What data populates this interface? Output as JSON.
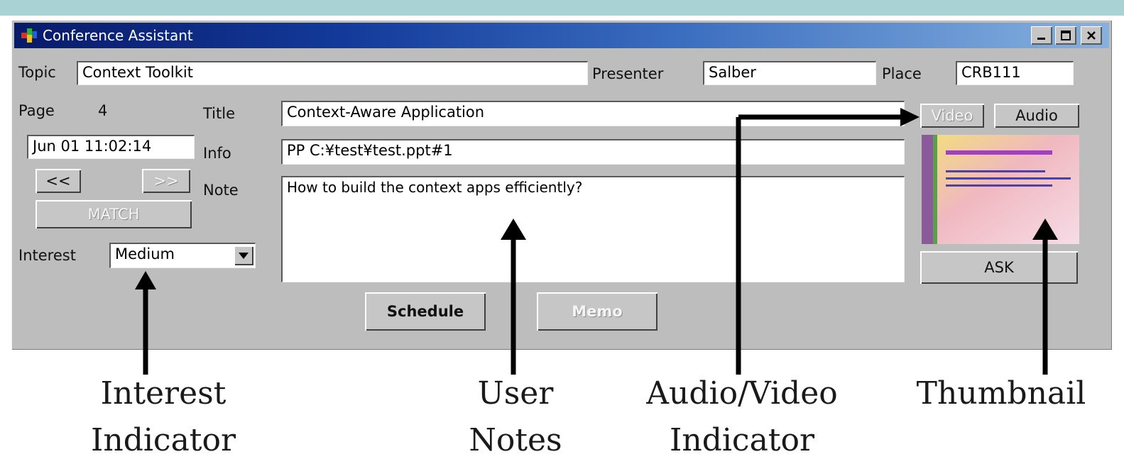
{
  "window": {
    "title": "Conference Assistant",
    "controls": {
      "minimize": "_",
      "maximize": "□",
      "close": "×"
    }
  },
  "header": {
    "topic_label": "Topic",
    "topic_value": "Context Toolkit",
    "presenter_label": "Presenter",
    "presenter_value": "Salber",
    "place_label": "Place",
    "place_value": "CRB111"
  },
  "left": {
    "page_label": "Page",
    "page_value": "4",
    "datetime": "Jun 01 11:02:14",
    "prev_label": "<<",
    "next_label": ">>",
    "match_label": "MATCH",
    "interest_label": "Interest",
    "interest_value": "Medium"
  },
  "main": {
    "title_label": "Title",
    "title_value": "Context-Aware Application",
    "info_label": "Info",
    "info_value": "PP C:¥test¥test.ppt#1",
    "note_label": "Note",
    "note_value": "How to build the context apps efficiently?"
  },
  "right": {
    "video_label": "Video",
    "audio_label": "Audio",
    "ask_label": "ASK"
  },
  "bottom": {
    "schedule_label": "Schedule",
    "memo_label": "Memo"
  },
  "annotations": {
    "interest": [
      "Interest",
      "Indicator"
    ],
    "notes": [
      "User",
      "Notes"
    ],
    "av": [
      "Audio/Video",
      "Indicator"
    ],
    "thumb": [
      "Thumbnail"
    ]
  },
  "colors": {
    "title_bar_start": "#081a6a",
    "title_bar_end": "#86b1df",
    "window_face": "#bdbdbd",
    "top_band": "#a8d2d4"
  }
}
